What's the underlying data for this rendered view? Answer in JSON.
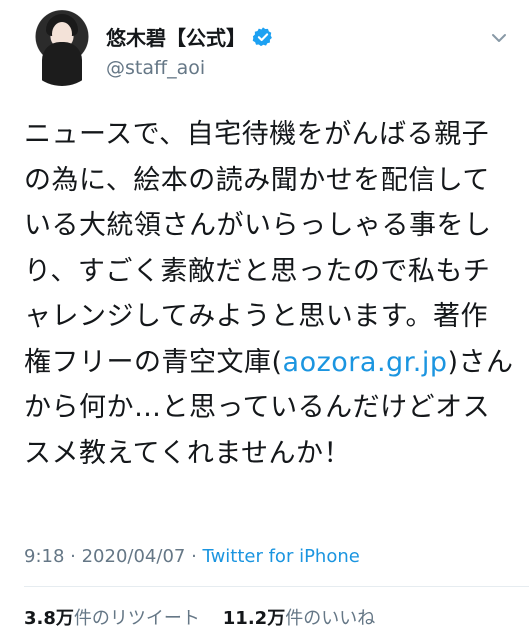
{
  "author": {
    "display_name": "悠木碧【公式】",
    "handle": "@staff_aoi",
    "verified": true
  },
  "tweet": {
    "text_before_link": "ニュースで、自宅待機をがんばる親子の為に、絵本の読み聞かせを配信している大統領さんがいらっしゃる事をしり、すごく素敵だと思ったので私もチャレンジしてみようと思います。著作権フリーの青空文庫(",
    "link_text": "aozora.gr.jp",
    "text_after_link": ")さんから何か…と思っているんだけどオススメ教えてくれませんか！"
  },
  "meta": {
    "time": "9:18",
    "separator": " · ",
    "date": "2020/04/07",
    "source": "Twitter for iPhone"
  },
  "stats": {
    "retweets_count": "3.8万",
    "retweets_label": "件のリツイート",
    "likes_count": "11.2万",
    "likes_label": "件のいいね"
  },
  "colors": {
    "link": "#1b95e0",
    "secondary": "#657786",
    "verified": "#1da1f2"
  },
  "icons": [
    "avatar",
    "verified-badge-icon",
    "chevron-down-icon"
  ]
}
